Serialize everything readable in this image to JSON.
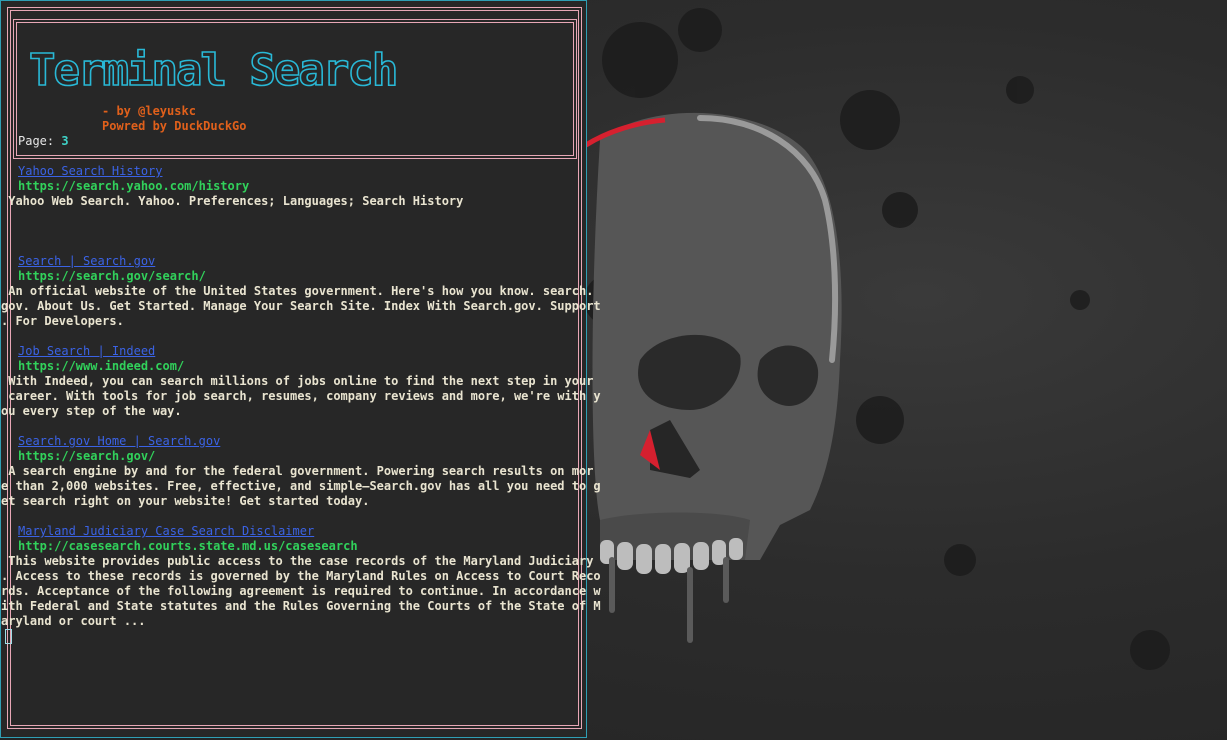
{
  "app": {
    "banner_title": "Terminal Search",
    "credit_by": "- by @leyuskc",
    "credit_powered": "Powred by DuckDuckGo",
    "page_label": "Page: ",
    "page_number": "3"
  },
  "results": [
    {
      "title": "Yahoo Search History",
      "url": "https://search.yahoo.com/history",
      "desc": [
        " Yahoo Web Search. Yahoo. Preferences; Languages; Search History"
      ]
    },
    {
      "title": "Search | Search.gov",
      "url": "https://search.gov/search/",
      "desc": [
        " An official website of the United States government. Here's how you know. search.",
        "gov. About Us. Get Started. Manage Your Search Site. Index With Search.gov. Support",
        ". For Developers."
      ]
    },
    {
      "title": "Job Search | Indeed",
      "url": "https://www.indeed.com/",
      "desc": [
        " With Indeed, you can search millions of jobs online to find the next step in your",
        " career. With tools for job search, resumes, company reviews and more, we're with y",
        "ou every step of the way."
      ]
    },
    {
      "title": "Search.gov Home | Search.gov",
      "url": "https://search.gov/",
      "desc": [
        " A search engine by and for the federal government. Powering search results on mor",
        "e than 2,000 websites. Free, effective, and simple—Search.gov has all you need to g",
        "et search right on your website! Get started today."
      ]
    },
    {
      "title": "Maryland Judiciary Case Search Disclaimer",
      "url": "http://casesearch.courts.state.md.us/casesearch",
      "desc": [
        " This website provides public access to the case records of the Maryland Judiciary",
        ". Access to these records is governed by the Maryland Rules on Access to Court Reco",
        "rds. Acceptance of the following agreement is required to continue. In accordance w",
        "ith Federal and State statutes and the Rules Governing the Courts of the State of M",
        "aryland or court ..."
      ]
    }
  ],
  "colors": {
    "border_pink": "#e8a7b6",
    "window_border": "#2f9fb5",
    "banner_cyan": "#29b8d6",
    "credit_orange": "#e0601b",
    "link_blue": "#3b63e6",
    "url_green": "#31d15b",
    "desc_text": "#e9e4d0",
    "skull_gray": "#575757",
    "accent_red": "#d6202f"
  },
  "wallpaper": {
    "icon": "skull-icon"
  }
}
